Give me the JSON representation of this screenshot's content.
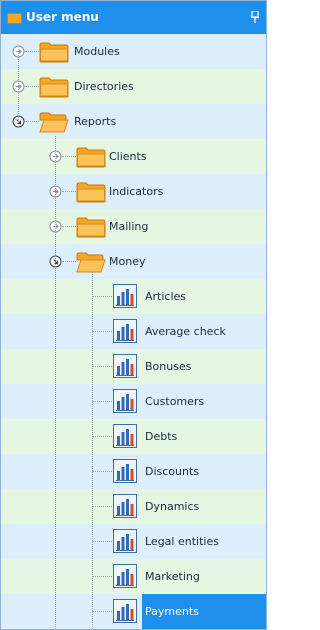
{
  "header": {
    "title": "User menu"
  },
  "colors": {
    "header": "#1e90ec",
    "row_even": "#ddeefc",
    "row_odd": "#e5f7e2",
    "selected": "#1e90ec",
    "folder": "#f6a623"
  },
  "tree": {
    "modules": "Modules",
    "directories": "Directories",
    "reports": "Reports",
    "clients": "Clients",
    "indicators": "Indicators",
    "mailing": "Mailing",
    "money": "Money",
    "articles": "Articles",
    "average_check": "Average check",
    "bonuses": "Bonuses",
    "customers": "Customers",
    "debts": "Debts",
    "discounts": "Discounts",
    "dynamics": "Dynamics",
    "legal_entities": "Legal entities",
    "marketing": "Marketing",
    "payments": "Payments"
  },
  "selected_item": "Payments"
}
